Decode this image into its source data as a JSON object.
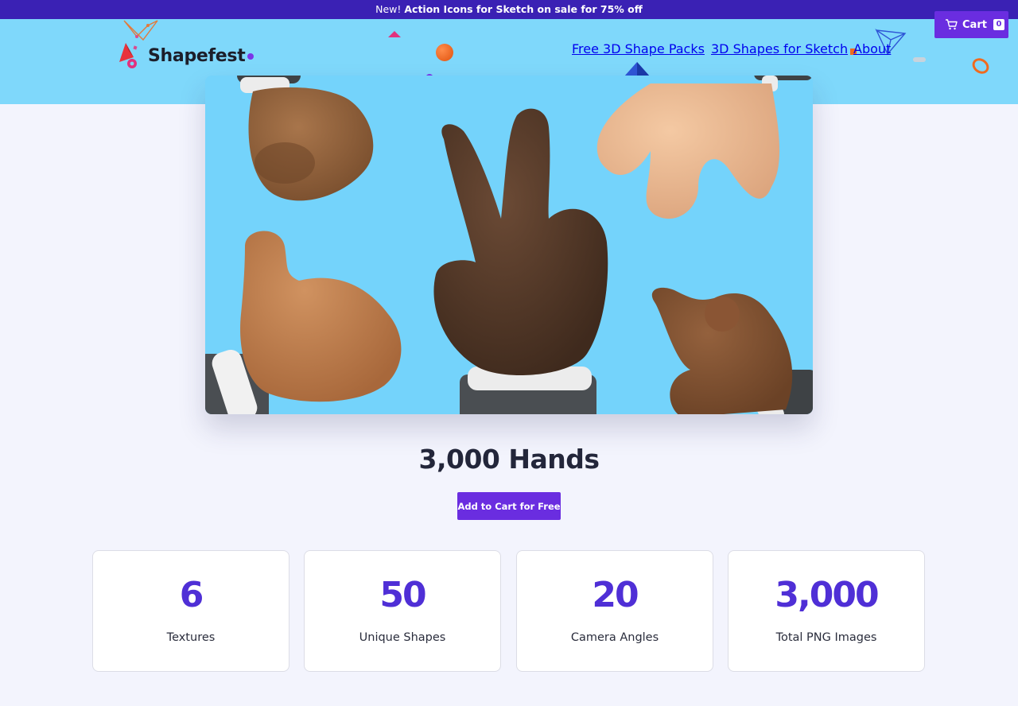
{
  "promo": {
    "prefix": "New!",
    "highlight": "Action Icons for Sketch on sale for 75% off"
  },
  "brand": {
    "name": "Shapefest"
  },
  "nav": {
    "items": [
      {
        "label": "Free 3D Shape Packs"
      },
      {
        "label": "3D Shapes for Sketch"
      },
      {
        "label": "About"
      }
    ]
  },
  "cart": {
    "label": "Cart",
    "count": "0"
  },
  "hero": {
    "icon": "hand-gestures-illustration"
  },
  "product": {
    "title": "3,000 Hands",
    "cta_label": "Add to Cart for Free"
  },
  "stats": [
    {
      "value": "6",
      "label": "Textures"
    },
    {
      "value": "50",
      "label": "Unique Shapes"
    },
    {
      "value": "20",
      "label": "Camera Angles"
    },
    {
      "value": "3,000",
      "label": "Total PNG Images"
    }
  ],
  "colors": {
    "accent": "#6a2de0",
    "promo_bg": "#3a21b4",
    "header_bg": "#7fd8fb",
    "stat_value": "#4f2fd6",
    "page_bg": "#f3f4fd"
  }
}
